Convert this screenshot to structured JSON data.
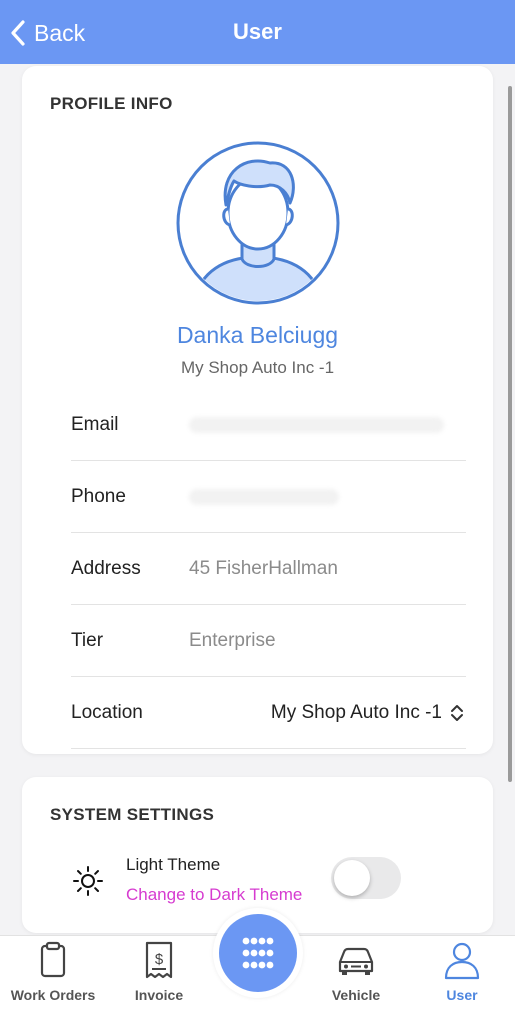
{
  "header": {
    "back_label": "Back",
    "title": "User"
  },
  "profile": {
    "section_title": "PROFILE INFO",
    "name": "Danka Belciugg",
    "company": "My Shop Auto Inc -1",
    "rows": {
      "email_label": "Email",
      "phone_label": "Phone",
      "address_label": "Address",
      "address_value": "45 FisherHallman",
      "tier_label": "Tier",
      "tier_value": "Enterprise",
      "location_label": "Location",
      "location_value": "My Shop Auto Inc -1"
    }
  },
  "settings": {
    "section_title": "SYSTEM SETTINGS",
    "theme_title": "Light Theme",
    "theme_link": "Change to Dark Theme",
    "dark_theme_enabled": false
  },
  "tabbar": {
    "tabs": [
      {
        "label": "Work Orders",
        "icon": "clipboard-icon"
      },
      {
        "label": "Invoice",
        "icon": "receipt-icon"
      },
      {
        "label": "Vehicle",
        "icon": "car-icon"
      },
      {
        "label": "User",
        "icon": "user-icon"
      }
    ],
    "active": "User",
    "center_icon": "grid-dots-icon"
  },
  "colors": {
    "accent": "#6b97f3",
    "link_pink": "#d63bd0",
    "name_blue": "#4e86df"
  }
}
